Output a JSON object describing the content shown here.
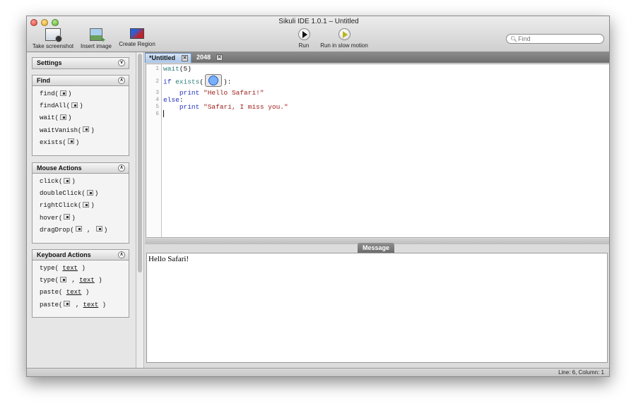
{
  "window": {
    "title": "Sikuli IDE 1.0.1 – Untitled"
  },
  "toolbar": {
    "take_screenshot": "Take screenshot",
    "insert_image": "Insert image",
    "create_region": "Create Region",
    "run": "Run",
    "run_slow": "Run in slow motion",
    "search_placeholder": "Find"
  },
  "sidebar": {
    "settings": {
      "title": "Settings"
    },
    "find": {
      "title": "Find",
      "items": [
        "find(",
        "findAll(",
        "wait(",
        "waitVanish(",
        "exists("
      ]
    },
    "mouse": {
      "title": "Mouse Actions",
      "items": [
        "click(",
        "doubleClick(",
        "rightClick(",
        "hover(",
        "dragDrop("
      ]
    },
    "keyboard": {
      "title": "Keyboard Actions",
      "items": [
        "type(",
        "type(",
        "paste(",
        "paste("
      ],
      "text_word": "text"
    },
    "close_paren": ")",
    "comma": ","
  },
  "tabs": [
    {
      "label": "*Untitled",
      "active": true
    },
    {
      "label": "2048",
      "active": false
    }
  ],
  "code": {
    "line_numbers": [
      "1",
      "2",
      "3",
      "4",
      "5",
      "6"
    ],
    "line1": {
      "fn": "wait",
      "args": "(5)"
    },
    "line2": {
      "kw": "if",
      "fn": "exists",
      "open": "(",
      "close": "):"
    },
    "line3": {
      "kw": "print",
      "str": "\"Hello Safari!\""
    },
    "line4": {
      "kw": "else",
      "punct": ":"
    },
    "line5": {
      "kw": "print",
      "str": "\"Safari, I miss you.\""
    }
  },
  "message": {
    "tab_label": "Message",
    "output": "Hello Safari!"
  },
  "status": {
    "position": "Line: 6, Column: 1"
  }
}
